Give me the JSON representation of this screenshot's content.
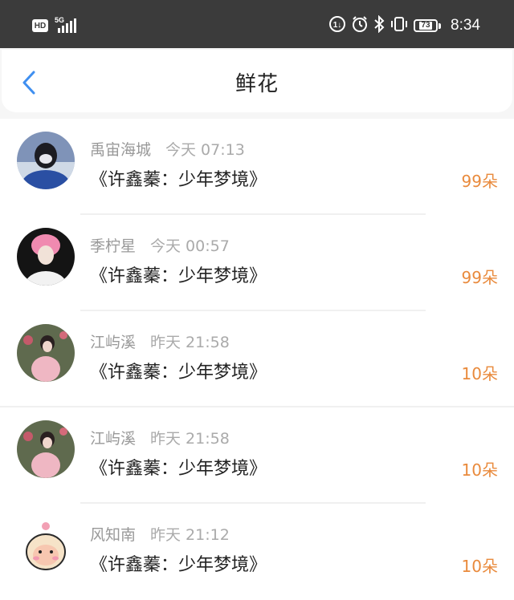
{
  "status_bar": {
    "hd_label": "HD",
    "network_label": "5G",
    "battery_level": "73",
    "time": "8:34"
  },
  "header": {
    "title": "鲜花",
    "back_icon": "chevron-left-icon"
  },
  "colors": {
    "accent_back": "#3f8ff0",
    "count_orange": "#e98a3c",
    "meta_gray": "#999999"
  },
  "flowers": [
    {
      "user": "禹宙海城",
      "time": "今天 07:13",
      "book": "《许鑫蓁：少年梦境》",
      "count": "99朵"
    },
    {
      "user": "季柠星",
      "time": "今天 00:57",
      "book": "《许鑫蓁：少年梦境》",
      "count": "99朵"
    },
    {
      "user": "江屿溪",
      "time": "昨天 21:58",
      "book": "《许鑫蓁：少年梦境》",
      "count": "10朵"
    },
    {
      "user": "江屿溪",
      "time": "昨天 21:58",
      "book": "《许鑫蓁：少年梦境》",
      "count": "10朵"
    },
    {
      "user": "风知南",
      "time": "昨天 21:12",
      "book": "《许鑫蓁：少年梦境》",
      "count": "10朵"
    }
  ]
}
